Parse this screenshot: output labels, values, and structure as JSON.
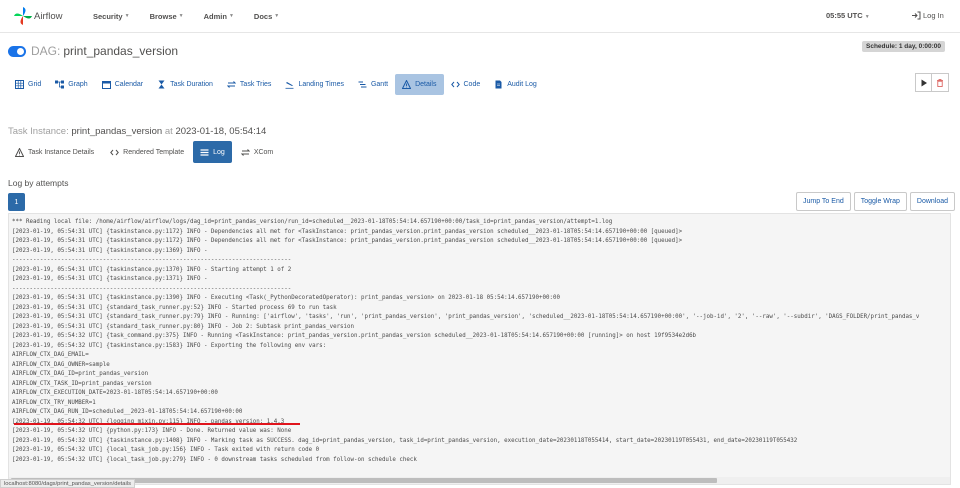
{
  "navbar": {
    "brand": "Airflow",
    "menu": [
      {
        "label": "Security"
      },
      {
        "label": "Browse"
      },
      {
        "label": "Admin"
      },
      {
        "label": "Docs"
      }
    ],
    "time": "05:55 UTC",
    "login": "Log In"
  },
  "dag": {
    "label": "DAG:",
    "id": "print_pandas_version",
    "schedule": "Schedule: 1 day, 0:00:00"
  },
  "tabs": [
    {
      "label": "Grid",
      "icon": "grid-icon"
    },
    {
      "label": "Graph",
      "icon": "graph-icon"
    },
    {
      "label": "Calendar",
      "icon": "calendar-icon"
    },
    {
      "label": "Task Duration",
      "icon": "hourglass-icon"
    },
    {
      "label": "Task Tries",
      "icon": "retry-icon"
    },
    {
      "label": "Landing Times",
      "icon": "plane-landing-icon"
    },
    {
      "label": "Gantt",
      "icon": "gantt-icon"
    },
    {
      "label": "Details",
      "icon": "warning-icon"
    },
    {
      "label": "Code",
      "icon": "code-icon"
    },
    {
      "label": "Audit Log",
      "icon": "file-icon"
    }
  ],
  "task_instance": {
    "label": "Task Instance:",
    "task_id": "print_pandas_version",
    "at": "at",
    "date": "2023-01-18, 05:54:14",
    "tabs": [
      {
        "label": "Task Instance Details",
        "icon": "warning-icon"
      },
      {
        "label": "Rendered Template",
        "icon": "code-icon"
      },
      {
        "label": "Log",
        "icon": "list-icon"
      },
      {
        "label": "XCom",
        "icon": "exchange-icon"
      }
    ]
  },
  "logs": {
    "heading": "Log by attempts",
    "attempt": "1",
    "buttons": {
      "jump": "Jump To End",
      "wrap": "Toggle Wrap",
      "download": "Download"
    },
    "lines": [
      "*** Reading local file: /home/airflow/airflow/logs/dag_id=print_pandas_version/run_id=scheduled__2023-01-18T05:54:14.657190+00:00/task_id=print_pandas_version/attempt=1.log",
      "[2023-01-19, 05:54:31 UTC] {taskinstance.py:1172} INFO - Dependencies all met for <TaskInstance: print_pandas_version.print_pandas_version scheduled__2023-01-18T05:54:14.657190+00:00 [queued]>",
      "[2023-01-19, 05:54:31 UTC] {taskinstance.py:1172} INFO - Dependencies all met for <TaskInstance: print_pandas_version.print_pandas_version scheduled__2023-01-18T05:54:14.657190+00:00 [queued]>",
      "[2023-01-19, 05:54:31 UTC] {taskinstance.py:1369} INFO -",
      "--------------------------------------------------------------------------------",
      "[2023-01-19, 05:54:31 UTC] {taskinstance.py:1370} INFO - Starting attempt 1 of 2",
      "[2023-01-19, 05:54:31 UTC] {taskinstance.py:1371} INFO -",
      "--------------------------------------------------------------------------------",
      "[2023-01-19, 05:54:31 UTC] {taskinstance.py:1390} INFO - Executing <Task(_PythonDecoratedOperator): print_pandas_version> on 2023-01-18 05:54:14.657190+00:00",
      "[2023-01-19, 05:54:31 UTC] {standard_task_runner.py:52} INFO - Started process 69 to run task",
      "[2023-01-19, 05:54:31 UTC] {standard_task_runner.py:79} INFO - Running: ['airflow', 'tasks', 'run', 'print_pandas_version', 'print_pandas_version', 'scheduled__2023-01-18T05:54:14.657190+00:00', '--job-id', '2', '--raw', '--subdir', 'DAGS_FOLDER/print_pandas_v",
      "[2023-01-19, 05:54:31 UTC] {standard_task_runner.py:80} INFO - Job 2: Subtask print_pandas_version",
      "[2023-01-19, 05:54:32 UTC] {task_command.py:375} INFO - Running <TaskInstance: print_pandas_version.print_pandas_version scheduled__2023-01-18T05:54:14.657190+00:00 [running]> on host 19f9534e2d6b",
      "[2023-01-19, 05:54:32 UTC] {taskinstance.py:1583} INFO - Exporting the following env vars:",
      "AIRFLOW_CTX_DAG_EMAIL=",
      "AIRFLOW_CTX_DAG_OWNER=sample",
      "AIRFLOW_CTX_DAG_ID=print_pandas_version",
      "AIRFLOW_CTX_TASK_ID=print_pandas_version",
      "AIRFLOW_CTX_EXECUTION_DATE=2023-01-18T05:54:14.657190+00:00",
      "AIRFLOW_CTX_TRY_NUMBER=1",
      "AIRFLOW_CTX_DAG_RUN_ID=scheduled__2023-01-18T05:54:14.657190+00:00",
      "[2023-01-19, 05:54:32 UTC] {logging_mixin.py:115} INFO - pandas version: 1.4.3",
      "[2023-01-19, 05:54:32 UTC] {python.py:173} INFO - Done. Returned value was: None",
      "[2023-01-19, 05:54:32 UTC] {taskinstance.py:1408} INFO - Marking task as SUCCESS. dag_id=print_pandas_version, task_id=print_pandas_version, execution_date=20230118T055414, start_date=20230119T055431, end_date=20230119T055432",
      "[2023-01-19, 05:54:32 UTC] {local_task_job.py:156} INFO - Task exited with return code 0",
      "[2023-01-19, 05:54:32 UTC] {local_task_job.py:279} INFO - 0 downstream tasks scheduled from follow-on schedule check"
    ]
  },
  "status_url": "localhost:8080/dags/print_pandas_version/details",
  "colors": {
    "accent": "#2c6aa8",
    "link": "#1a5aa6",
    "highlight": "#e0141c",
    "toggle": "#1a73e8"
  }
}
